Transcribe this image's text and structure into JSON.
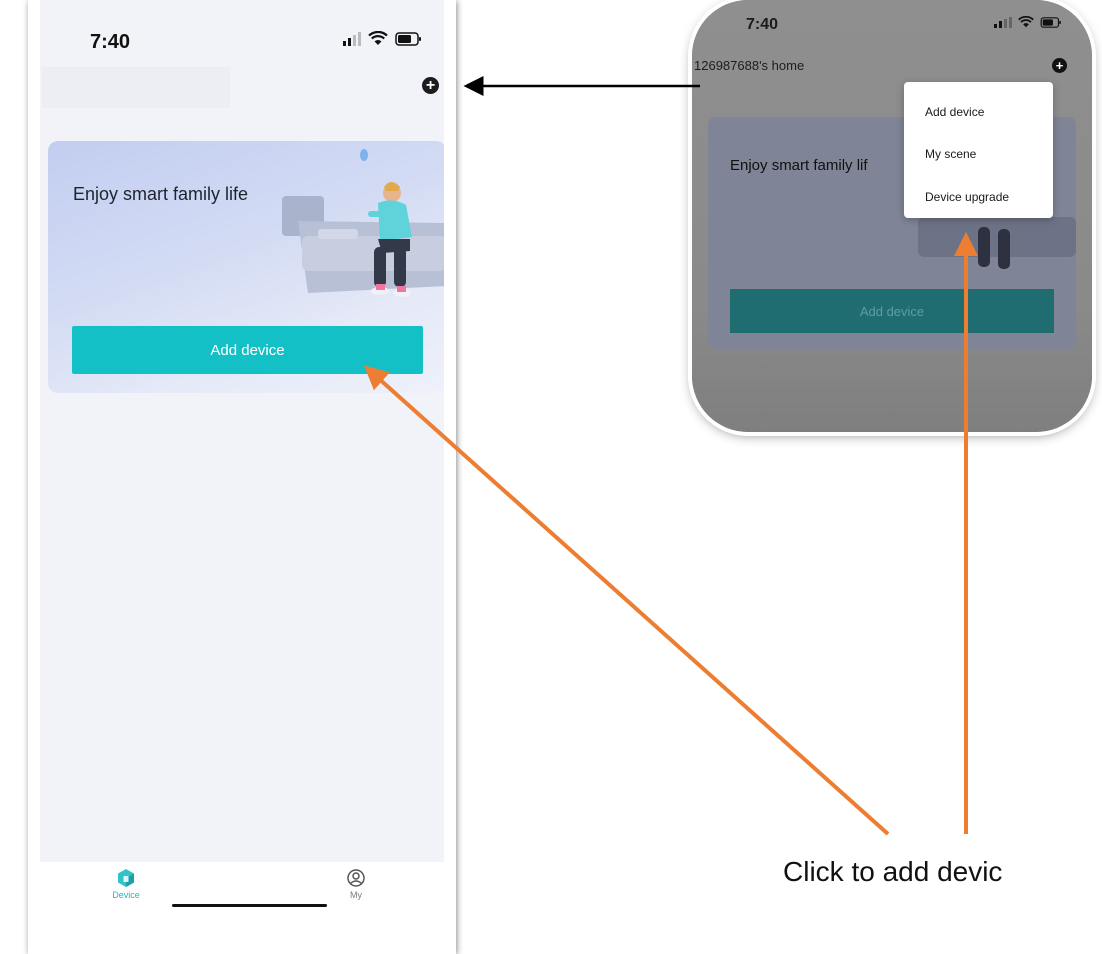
{
  "left_phone": {
    "status": {
      "time": "7:40"
    },
    "banner": {
      "title": "Enjoy smart family life",
      "add_button_label": "Add device"
    },
    "tabs": [
      {
        "label": "Device",
        "icon": "device-cube-icon",
        "active": true
      },
      {
        "label": "My",
        "icon": "profile-icon",
        "active": false
      }
    ]
  },
  "right_phone": {
    "status": {
      "time": "7:40"
    },
    "home_name": "126987688's home",
    "banner": {
      "title": "Enjoy smart family lif",
      "add_button_label": "Add device"
    },
    "menu": {
      "items": [
        "Add device",
        "My scene",
        "Device upgrade"
      ]
    }
  },
  "caption": "Click to add devic",
  "colors": {
    "accent": "#13c0c6",
    "arrow_orange": "#ed7d31",
    "arrow_black": "#000000",
    "tab_active": "#24b5bd"
  }
}
